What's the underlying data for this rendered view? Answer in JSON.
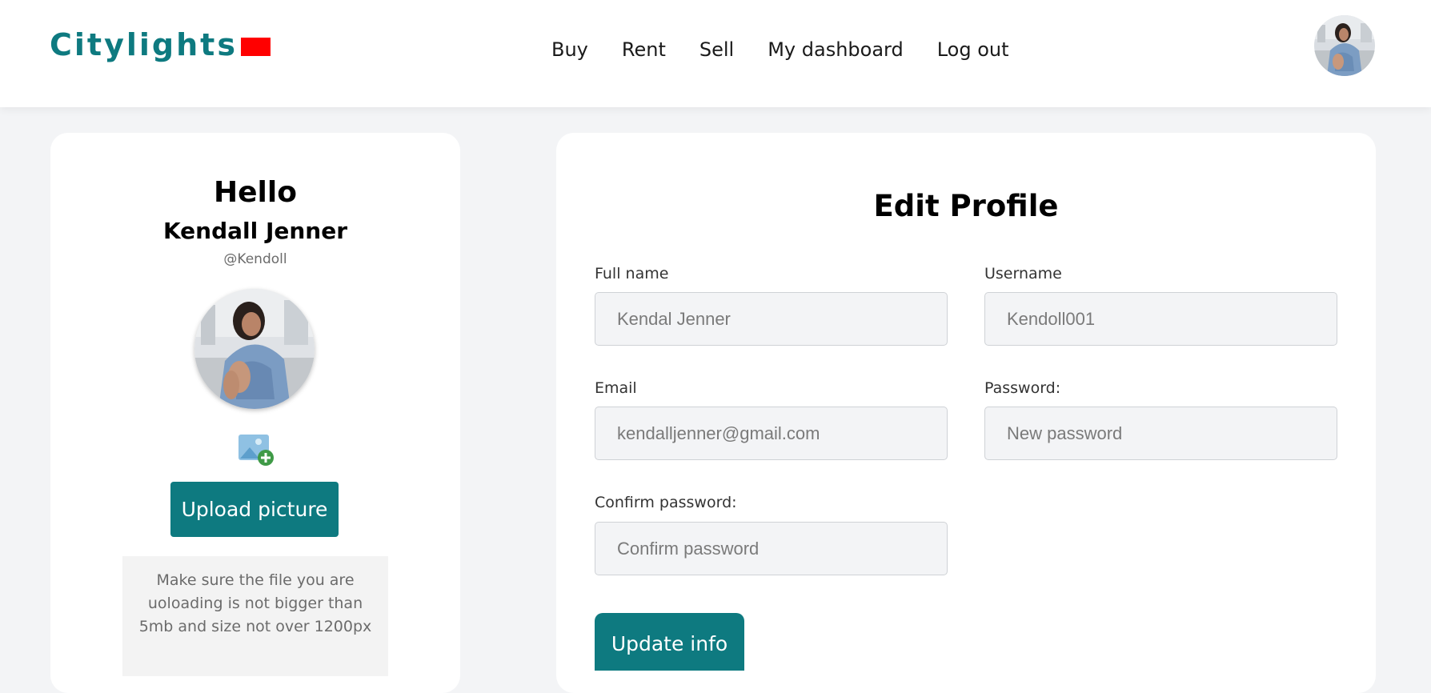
{
  "header": {
    "logo_text": "Citylights",
    "nav": [
      {
        "label": "Buy"
      },
      {
        "label": "Rent"
      },
      {
        "label": "Sell"
      },
      {
        "label": "My dashboard"
      },
      {
        "label": "Log out"
      }
    ]
  },
  "profile_card": {
    "greeting": "Hello",
    "full_name": "Kendall Jenner",
    "handle": "@Kendoll",
    "upload_button": "Upload picture",
    "note": "Make sure the file you are uoloading is not bigger than 5mb and size not over 1200px"
  },
  "edit_form": {
    "title": "Edit Profile",
    "fields": {
      "full_name": {
        "label": "Full name",
        "placeholder": "Kendal Jenner"
      },
      "username": {
        "label": "Username",
        "placeholder": "Kendoll001"
      },
      "email": {
        "label": "Email",
        "placeholder": "kendalljenner@gmail.com"
      },
      "password": {
        "label": "Password:",
        "placeholder": "New password"
      },
      "confirm_password": {
        "label": "Confirm password:",
        "placeholder": "Confirm password"
      }
    },
    "submit_button": "Update info"
  },
  "colors": {
    "brand": "#0e7a80",
    "flag": "#ff0000",
    "page_bg": "#f3f4f6"
  }
}
